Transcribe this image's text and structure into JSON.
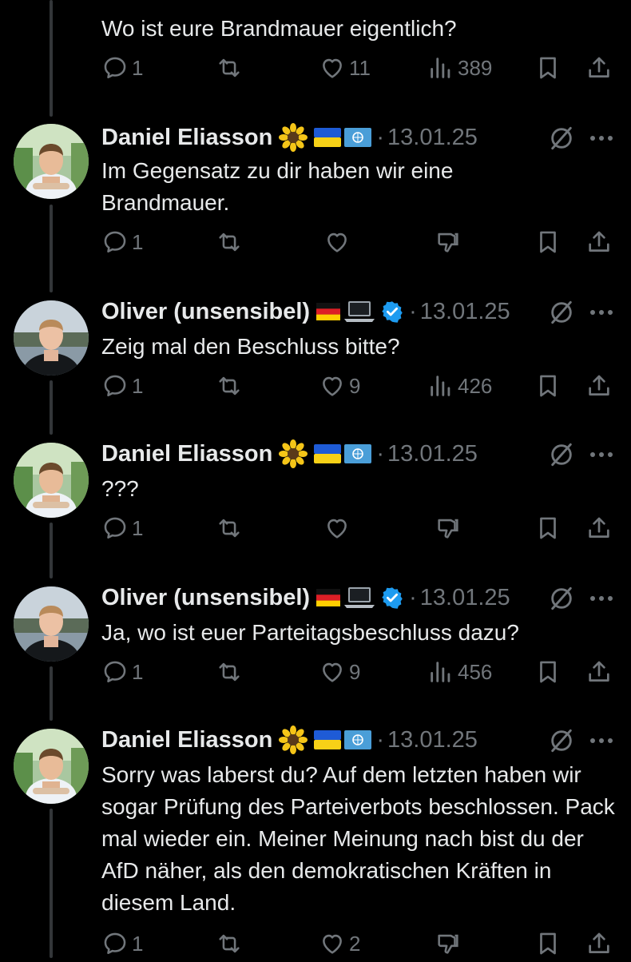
{
  "tweets": [
    {
      "text": "Wo ist eure Brandmauer eigentlich?",
      "replies": "1",
      "likes": "11",
      "views": "389",
      "variant": "views"
    },
    {
      "name": "Daniel Eliasson",
      "avatar": "daniel",
      "flags": [
        "sunflower",
        "ukraine-flag",
        "un-flag"
      ],
      "verified": false,
      "date": "13.01.25",
      "text": "Im Gegensatz zu dir haben wir eine Brandmauer.",
      "replies": "1",
      "likes": "",
      "variant": "dislike"
    },
    {
      "name": "Oliver (unsensibel)",
      "avatar": "oliver",
      "flags": [
        "germany-flag",
        "laptop"
      ],
      "verified": true,
      "date": "13.01.25",
      "text": "Zeig mal den Beschluss bitte?",
      "replies": "1",
      "likes": "9",
      "views": "426",
      "variant": "views"
    },
    {
      "name": "Daniel Eliasson",
      "avatar": "daniel",
      "flags": [
        "sunflower",
        "ukraine-flag",
        "un-flag"
      ],
      "verified": false,
      "date": "13.01.25",
      "text": "???",
      "replies": "1",
      "likes": "",
      "variant": "dislike"
    },
    {
      "name": "Oliver (unsensibel)",
      "avatar": "oliver",
      "flags": [
        "germany-flag",
        "laptop"
      ],
      "verified": true,
      "date": "13.01.25",
      "text": "Ja, wo ist euer Parteitagsbeschluss dazu?",
      "replies": "1",
      "likes": "9",
      "views": "456",
      "variant": "views"
    },
    {
      "name": "Daniel Eliasson",
      "avatar": "daniel",
      "flags": [
        "sunflower",
        "ukraine-flag",
        "un-flag"
      ],
      "verified": false,
      "date": "13.01.25",
      "text": "Sorry was laberst du? Auf dem letzten haben wir sogar Prüfung des Parteiverbots beschlossen. Pack mal wieder ein. Meiner Meinung nach bist du der AfD näher, als den demokratischen Kräften in diesem Land.",
      "replies": "1",
      "likes": "2",
      "variant": "dislike"
    }
  ],
  "colors": {
    "background": "#000000",
    "text": "#e7e9ea",
    "muted": "#71767b",
    "verified": "#1d9bf0",
    "thread_line": "#333639"
  },
  "separator": "·"
}
